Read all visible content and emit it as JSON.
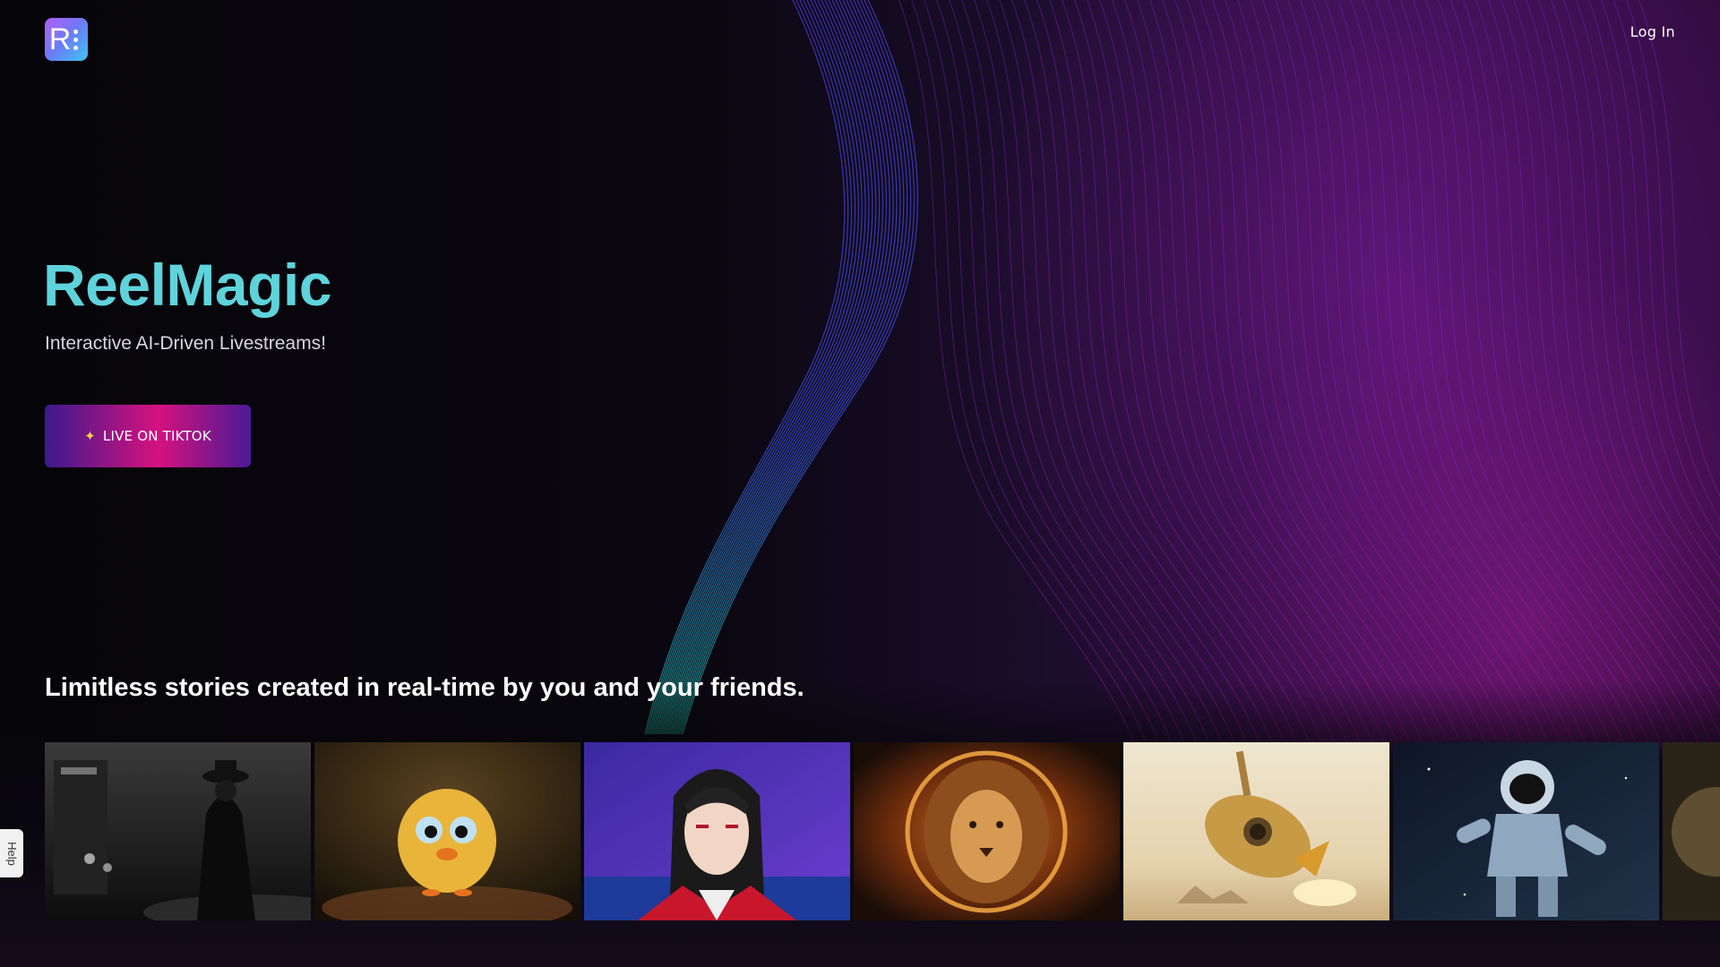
{
  "header": {
    "logo_alt": "R",
    "login_label": "Log In"
  },
  "hero": {
    "title": "ReelMagic",
    "subtitle": "Interactive AI-Driven Livestreams!",
    "cta_label": "LIVE ON TIKTOK",
    "cta_icon": "sparkle-icon"
  },
  "gallery": {
    "title": "Limitless stories created in real-time by you and your friends.",
    "items": [
      {
        "subject": "noir-detective"
      },
      {
        "subject": "cartoon-chick"
      },
      {
        "subject": "anime-vampire"
      },
      {
        "subject": "fire-lion"
      },
      {
        "subject": "desert-rocket"
      },
      {
        "subject": "space-astronaut"
      },
      {
        "subject": "partial-thumbnail"
      }
    ]
  },
  "help": {
    "label": "Help"
  },
  "colors": {
    "title_accent": "#5fd3dc",
    "cta_gradient_start": "#3b1a8c",
    "cta_gradient_mid": "#d5127e",
    "logo_gradient_start": "#b25cf5",
    "logo_gradient_end": "#3fc6f2"
  }
}
